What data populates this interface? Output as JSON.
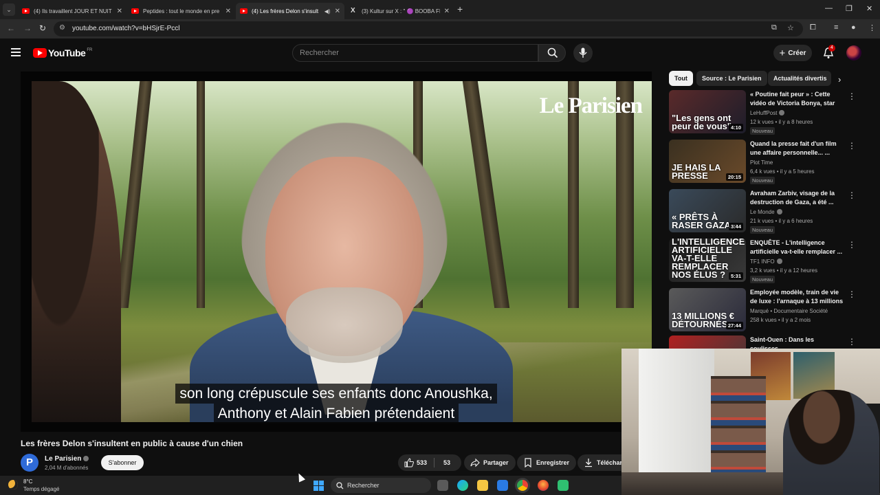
{
  "browser": {
    "tabs": [
      {
        "title": "(4) Ils travaillent JOUR ET NUIT",
        "icon": "youtube-icon",
        "active": false
      },
      {
        "title": "Peptides : tout le monde en pre",
        "icon": "youtube-icon",
        "active": false
      },
      {
        "title": "(4) Les frères Delon s'insult",
        "icon": "youtube-icon",
        "active": true
      },
      {
        "title": "(3) Kultur sur X : \" 🟣 BOOBA FI",
        "icon": "x-icon",
        "active": false
      }
    ],
    "new_tab_label": "+",
    "url": "youtube.com/watch?v=bHSjrE-Pccl"
  },
  "youtube_header": {
    "logo_text": "YouTube",
    "logo_region": "FR",
    "search_placeholder": "Rechercher",
    "create_label": "Créer",
    "notification_count": "4"
  },
  "video": {
    "watermark": "Le Parisien",
    "subtitle_lines": [
      "son long crépuscule ses enfants donc Anoushka,",
      "Anthony et Alain Fabien prétendaient"
    ],
    "title": "Les frères Delon s'insultent en public à cause d'un chien",
    "channel": {
      "avatar_letter": "P",
      "name": "Le Parisien",
      "subscribers": "2,04 M d'abonnés",
      "subscribe_label": "S'abonner"
    },
    "likes": "533",
    "dislikes": "53",
    "share_label": "Partager",
    "save_label": "Enregistrer",
    "download_label": "Téléchar"
  },
  "sidebar": {
    "chips": [
      "Tout",
      "Source : Le Parisien",
      "Actualités divertis"
    ],
    "recommendations": [
      {
        "title": "« Poutine fait peur » : Cette vidéo de Victoria Bonya, star d...",
        "channel": "LeHuffPost",
        "verified": true,
        "meta": "12 k vues • il y a 8 heures",
        "badge": "Nouveau",
        "duration": "4:10",
        "thumb_caption": "\"Les gens ont peur de vous\"",
        "thumb_colors": [
          "#5a2a2a",
          "#1d1d2a"
        ]
      },
      {
        "title": "Quand la presse fait d'un film une affaire personnelle... ...",
        "channel": "Plot Time",
        "verified": false,
        "meta": "6,4 k vues • il y a 5 heures",
        "badge": "Nouveau",
        "duration": "20:15",
        "thumb_caption": "JE HAIS LA PRESSE",
        "thumb_colors": [
          "#3a3020",
          "#6a4a2a"
        ]
      },
      {
        "title": "Avraham Zarbiv, visage de la destruction de Gaza, a été ...",
        "channel": "Le Monde",
        "verified": true,
        "meta": "21 k vues • il y a 6 heures",
        "badge": "Nouveau",
        "duration": "3:44",
        "thumb_caption": "« PRÊTS À RASER GAZA »",
        "thumb_colors": [
          "#3a4a5a",
          "#2a2a2a"
        ]
      },
      {
        "title": "ENQUÊTE - L'intelligence artificielle va-t-elle remplacer ...",
        "channel": "TF1 INFO",
        "verified": true,
        "meta": "3,2 k vues • il y a 12 heures",
        "badge": "Nouveau",
        "duration": "5:31",
        "thumb_caption": "L'INTELLIGENCE ARTIFICIELLE VA-T-ELLE REMPLACER NOS ÉLUS ?",
        "thumb_colors": [
          "#1a1a1a",
          "#3a3a3a"
        ]
      },
      {
        "title": "Employée modèle, train de vie de luxe : l'arnaque à 13 millions",
        "channel": "Marqué • Documentaire Société",
        "verified": false,
        "meta": "258 k vues • il y a 2 mois",
        "badge": "",
        "duration": "27:44",
        "thumb_caption": "13 MILLIONS € DÉTOURNÉS",
        "thumb_colors": [
          "#5a5a5a",
          "#2a2a3a"
        ]
      },
      {
        "title": "Saint-Ouen : Dans les coulisses",
        "channel": "",
        "verified": false,
        "meta": "",
        "badge": "",
        "duration": "",
        "thumb_caption": "",
        "thumb_colors": [
          "#b02020",
          "#3a3a3a"
        ]
      }
    ]
  },
  "taskbar": {
    "temperature": "8°C",
    "weather": "Temps dégagé",
    "search_label": "Rechercher"
  }
}
